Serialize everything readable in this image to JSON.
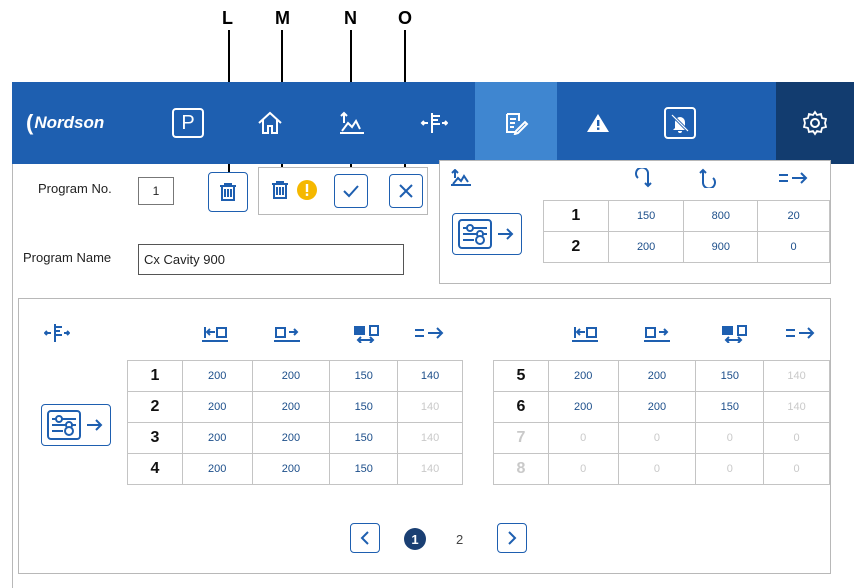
{
  "callouts": [
    "L",
    "M",
    "N",
    "O"
  ],
  "nav": {
    "logo": "Nordson",
    "items": [
      {
        "name": "program-nav",
        "label": "P"
      },
      {
        "name": "home-nav"
      },
      {
        "name": "valve-nav"
      },
      {
        "name": "hotrunner-nav"
      },
      {
        "name": "edit-nav",
        "active": true
      },
      {
        "name": "alarm-nav"
      },
      {
        "name": "bell-nav"
      },
      {
        "name": "settings-nav"
      }
    ]
  },
  "program": {
    "number_label": "Program No.",
    "number_value": "1",
    "name_label": "Program Name",
    "name_value": "Cx Cavity 900"
  },
  "top_table": {
    "rows": [
      {
        "id": "1",
        "values": [
          "150",
          "800",
          "20"
        ]
      },
      {
        "id": "2",
        "values": [
          "200",
          "900",
          "0"
        ]
      }
    ]
  },
  "bottom_left_table": {
    "rows": [
      {
        "id": "1",
        "values": [
          "200",
          "200",
          "150",
          "140"
        ],
        "dim": [
          false,
          false,
          false,
          false
        ]
      },
      {
        "id": "2",
        "values": [
          "200",
          "200",
          "150",
          "140"
        ],
        "dim": [
          false,
          false,
          false,
          true
        ]
      },
      {
        "id": "3",
        "values": [
          "200",
          "200",
          "150",
          "140"
        ],
        "dim": [
          false,
          false,
          false,
          true
        ]
      },
      {
        "id": "4",
        "values": [
          "200",
          "200",
          "150",
          "140"
        ],
        "dim": [
          false,
          false,
          false,
          true
        ]
      }
    ]
  },
  "bottom_right_table": {
    "rows": [
      {
        "id": "5",
        "values": [
          "200",
          "200",
          "150",
          "140"
        ],
        "dim": [
          false,
          false,
          false,
          true
        ],
        "iddim": false
      },
      {
        "id": "6",
        "values": [
          "200",
          "200",
          "150",
          "140"
        ],
        "dim": [
          false,
          false,
          false,
          true
        ],
        "iddim": false
      },
      {
        "id": "7",
        "values": [
          "0",
          "0",
          "0",
          "0"
        ],
        "dim": [
          true,
          true,
          true,
          true
        ],
        "iddim": true
      },
      {
        "id": "8",
        "values": [
          "0",
          "0",
          "0",
          "0"
        ],
        "dim": [
          true,
          true,
          true,
          true
        ],
        "iddim": true
      }
    ]
  },
  "pagination": {
    "current": "1",
    "other": "2"
  },
  "colors": {
    "nav_blue": "#1e5fb0",
    "nav_active": "#3f86d0",
    "nav_dark": "#123c6f",
    "warning": "#f5b800"
  }
}
